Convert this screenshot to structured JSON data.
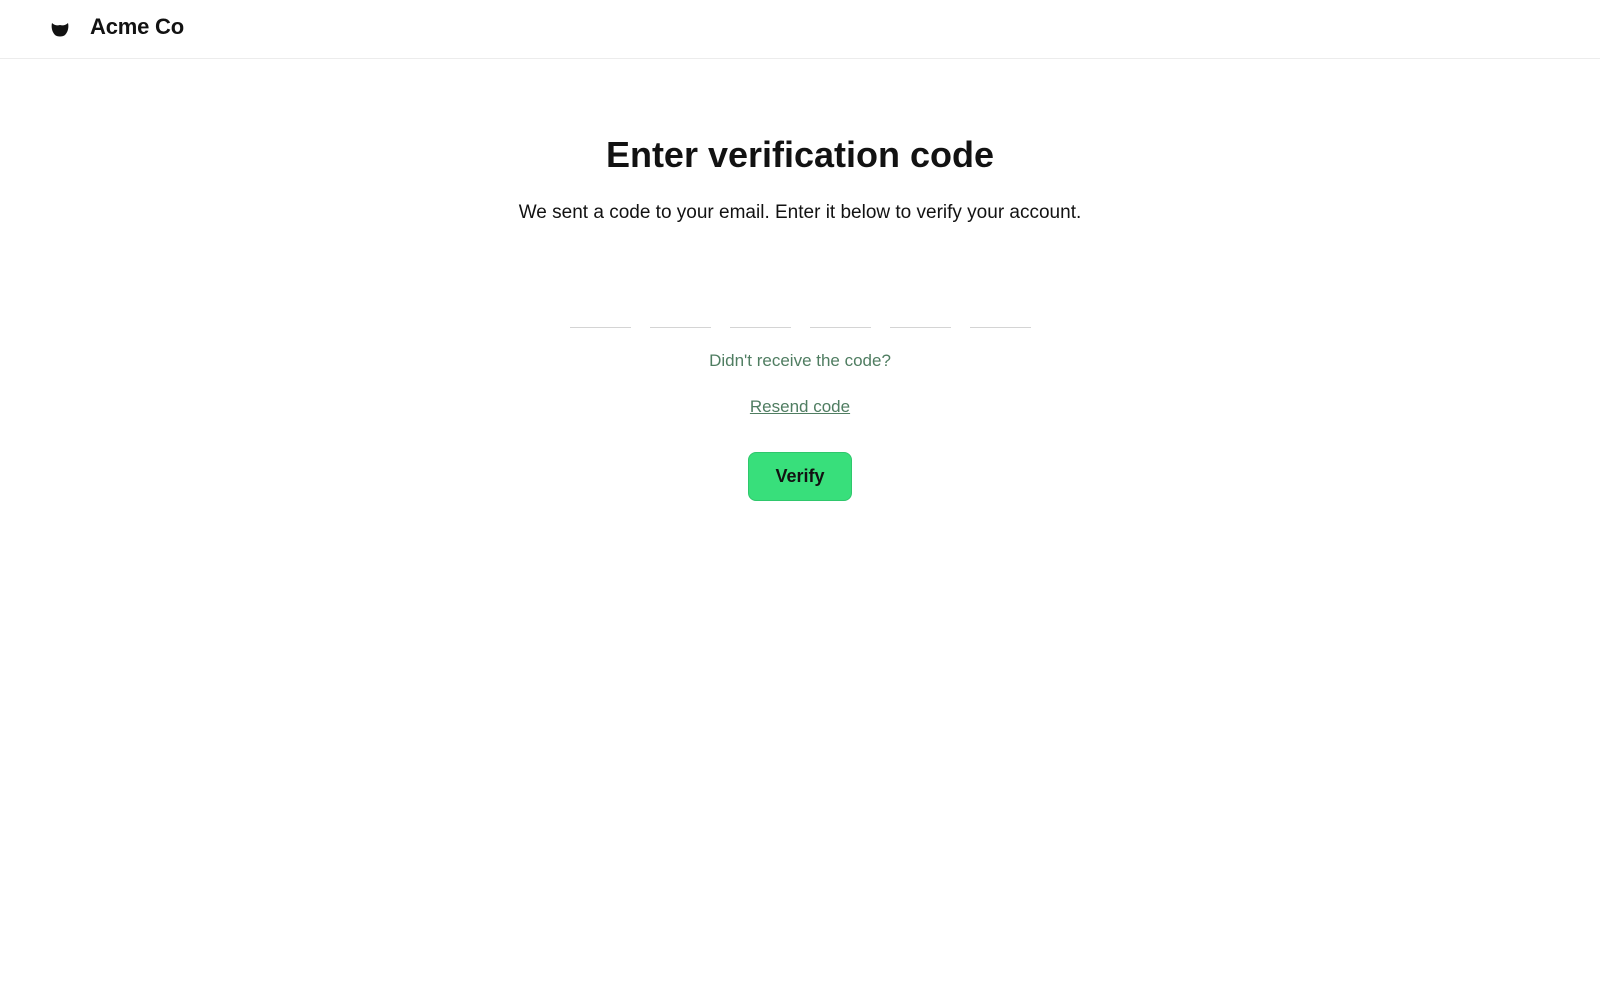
{
  "header": {
    "brand": "Acme Co",
    "logo_icon": "acme-logo-icon"
  },
  "main": {
    "title": "Enter verification code",
    "subtitle": "We sent a code to your email. Enter it below to verify your account.",
    "code_fields": [
      {
        "value": ""
      },
      {
        "value": ""
      },
      {
        "value": ""
      },
      {
        "value": ""
      },
      {
        "value": ""
      },
      {
        "value": ""
      }
    ],
    "hint": "Didn't receive the code?",
    "resend_label": "Resend code",
    "verify_label": "Verify"
  },
  "colors": {
    "accent": "#38df7b",
    "link": "#4f7d61",
    "text": "#121212"
  }
}
